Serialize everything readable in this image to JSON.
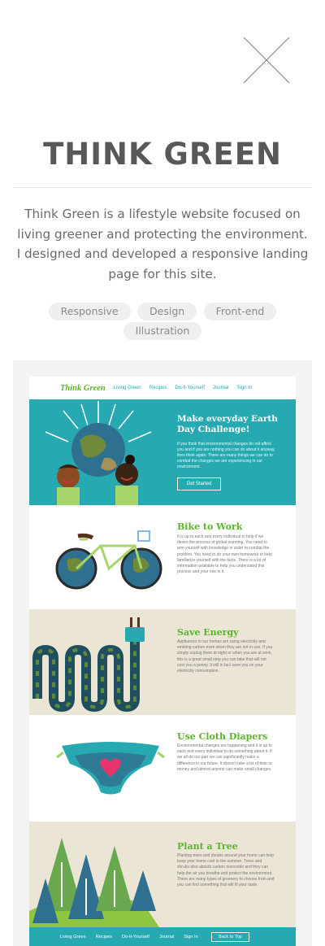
{
  "modal": {
    "title": "THINK GREEN",
    "description": "Think Green is a lifestyle website focused on living greener and protecting the environment. I designed and developed a responsive landing page for this site.",
    "tags": [
      "Responsive",
      "Design",
      "Front-end",
      "Illustration"
    ],
    "close_icon": "close-icon"
  },
  "preview": {
    "logo": "Think Green",
    "nav": [
      "Living Green",
      "Recipes",
      "Do-It-Yourself",
      "Journal",
      "Sign In"
    ],
    "hero": {
      "heading": "Make everyday Earth Day Challenge!",
      "text": "If you think that environmental changes do not affect you and if you are nothing you can do about it anyway, then think again. There are many things we can do to combat the changes we are experiencing in our environment.",
      "button": "Get Started"
    },
    "sections": [
      {
        "heading": "Bike to Work",
        "text": "It is up to each and every individual to help if we desire the process of global warming. You need to arm yourself with knowledge in order to combat the problem. You need to do your own homework to help familiarize yourself with the facts. There is a lot of information available to help you understand this process and your role in it."
      },
      {
        "heading": "Save Energy",
        "text": "Appliances in our homes are using electricity and emitting carbon even when they are not in use. If you simply unplug them at night or when you are at work, this is a great small step you can take that will not cost you a penny. It will in fact save you on your electricity consumption."
      },
      {
        "heading": "Use Cloth Diapers",
        "text": "Environmental changes are happening and it is up to each and every individual to do something about it. If we all do our part we can significantly make a difference in our future. It doesn't take a lot of time or money and almost anyone can make small changes."
      },
      {
        "heading": "Plant a Tree",
        "text": "Planting trees and shrubs around your home can help keep your home cool in the summer. Trees and shrubs also absorb carbon monoxide and they can help the air you breathe and protect the environment. There are many types of greenery to choose from and you can find something that will fit your taste."
      }
    ],
    "footer": {
      "links": [
        "Living Green",
        "Recipes",
        "Do-It-Yourself",
        "Journal",
        "Sign In"
      ],
      "button": "Back to Top"
    }
  },
  "colors": {
    "accent_green": "#5bb42a",
    "teal": "#27a9b1",
    "beige": "#ebe5d6"
  }
}
